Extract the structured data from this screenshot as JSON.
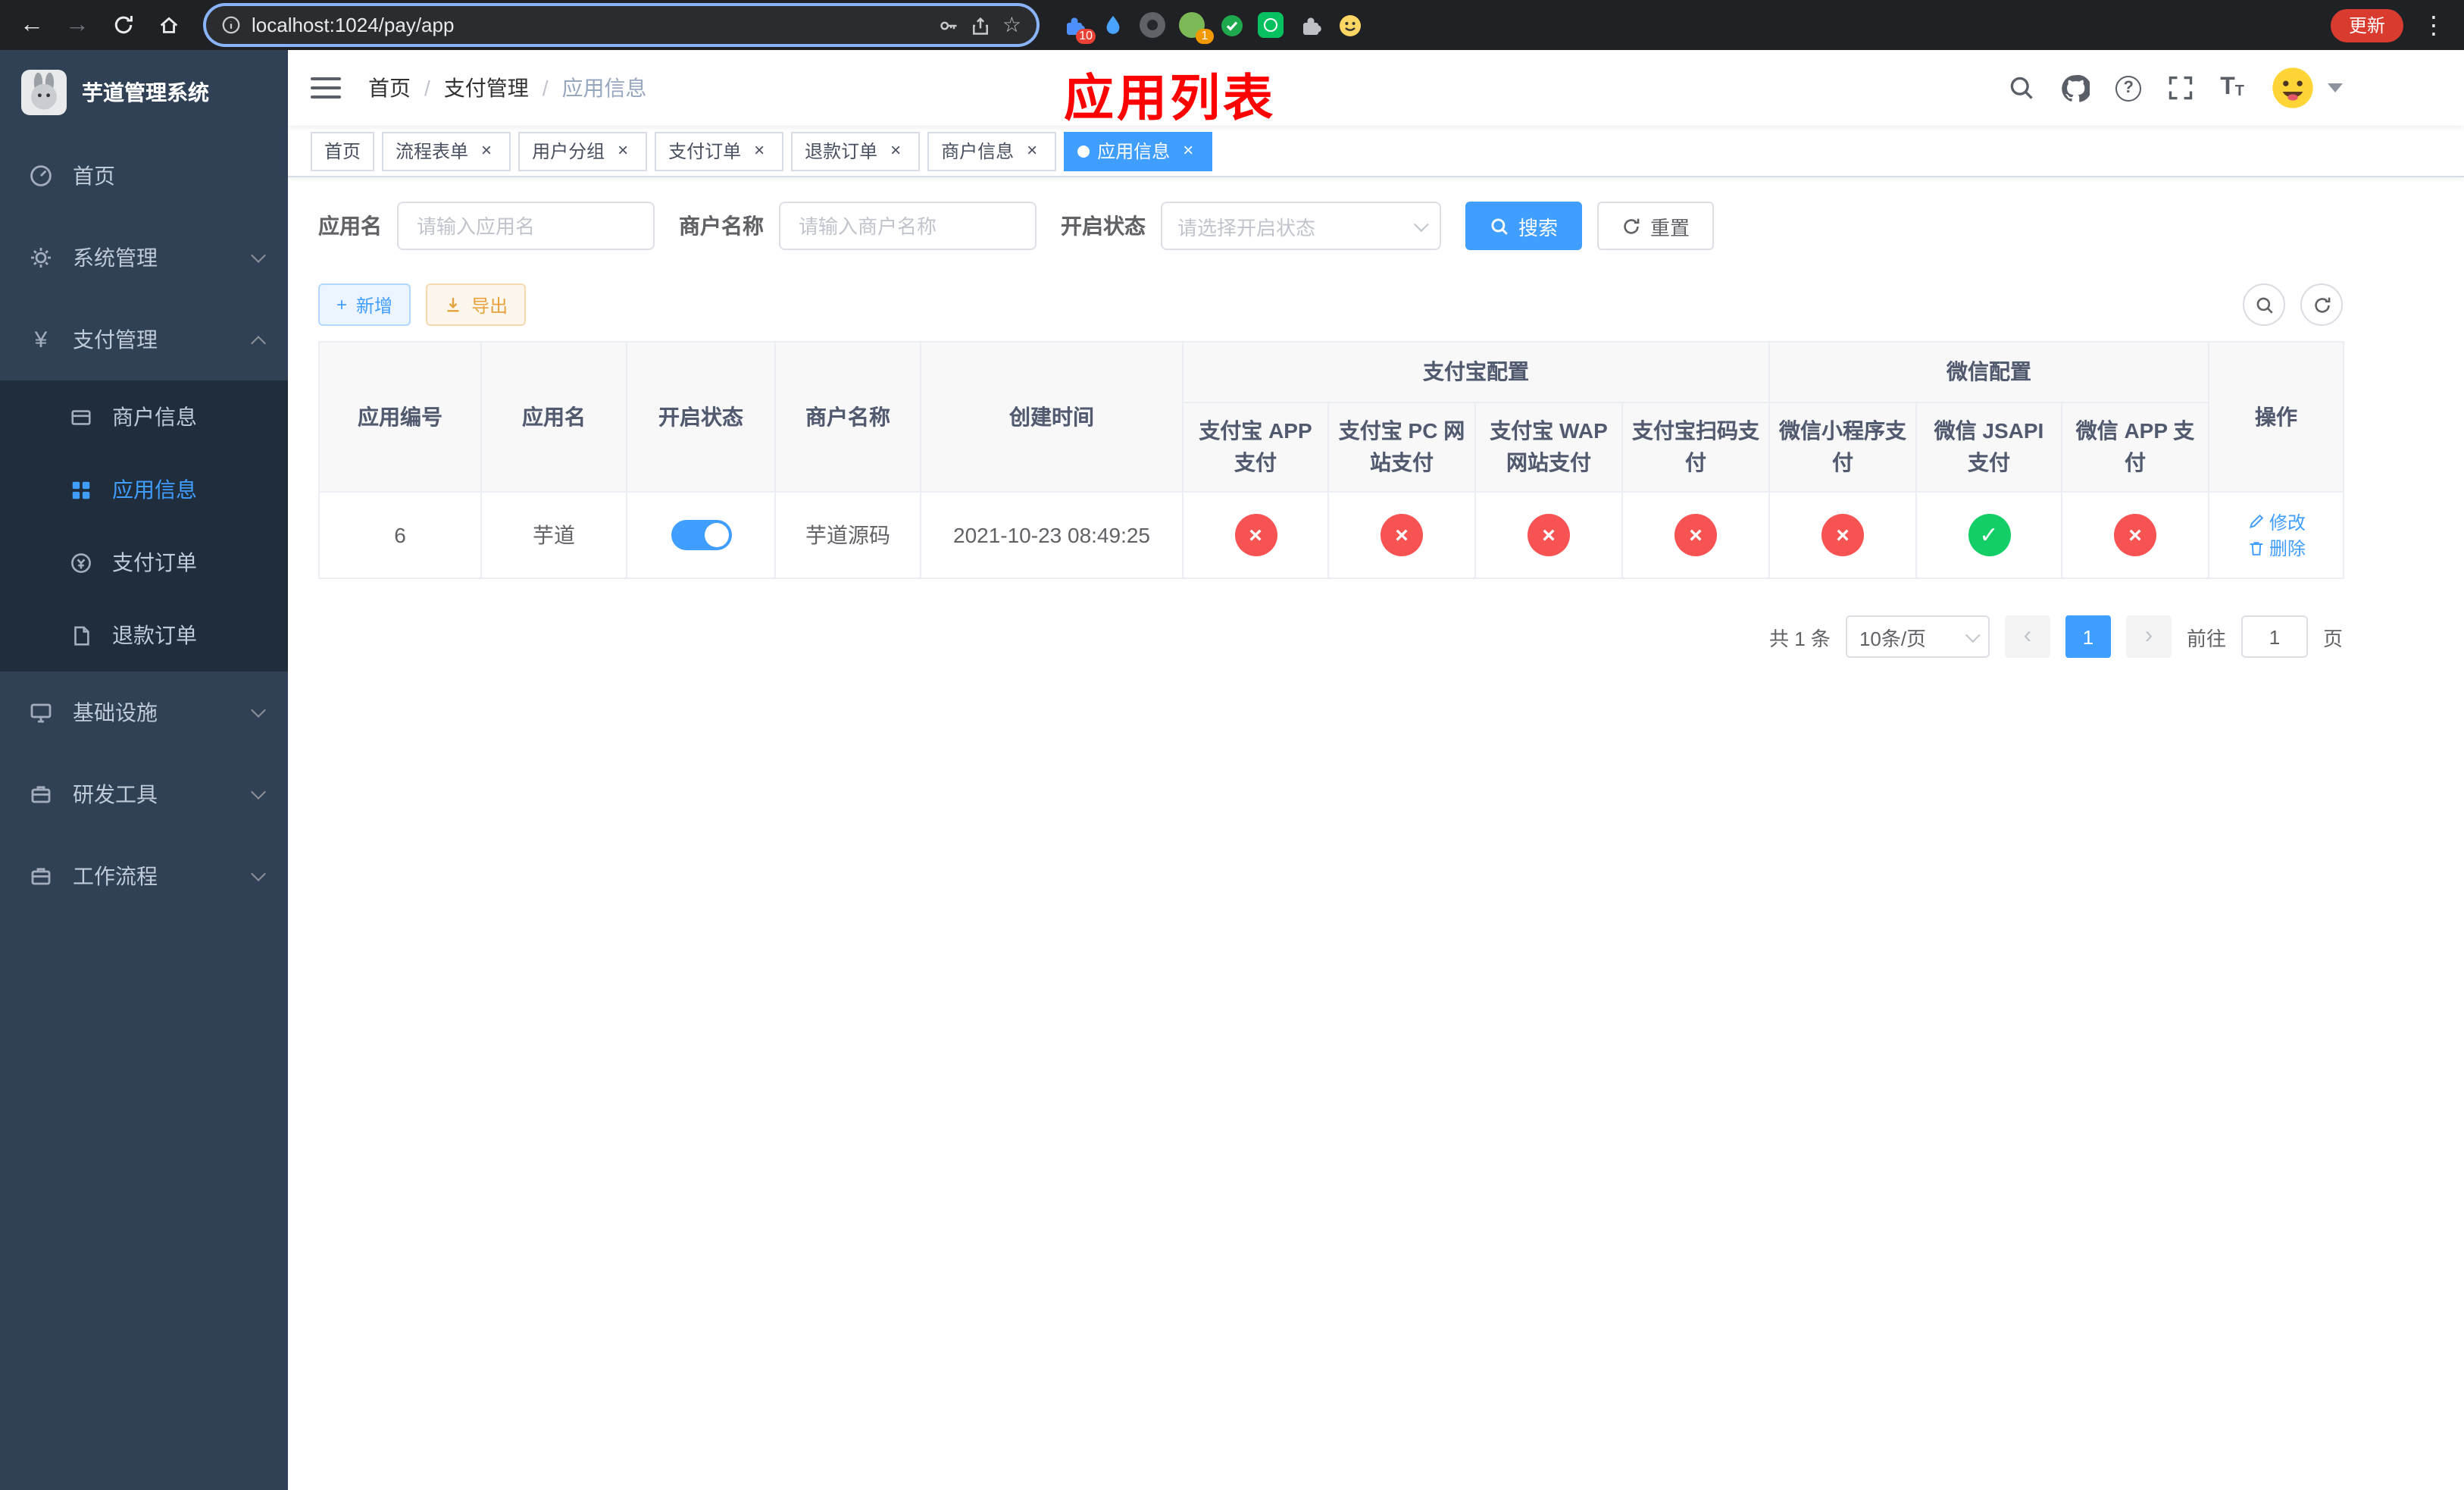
{
  "colors": {
    "accent": "#409eff",
    "success": "#13ce66",
    "danger": "#f75353",
    "warning": "#e6a23c",
    "annotation-red": "#ff0000",
    "sidebar-bg": "#304156",
    "sidebar-sub-bg": "#1f2d3d",
    "sidebar-text": "#bfcbd9",
    "chrome-bg": "#202124",
    "chrome-update": "#d93b2e"
  },
  "icons": {
    "back": "←",
    "forward": "→",
    "star": "☆",
    "menu_dots": "⋮",
    "help": "?",
    "plus": "+",
    "yen": "¥",
    "font_size": "T",
    "close": "×",
    "breadcrumb_separator": "/",
    "prev": "‹",
    "next": "›",
    "status_yes": "✓",
    "status_no": "×"
  },
  "browser": {
    "url": "localhost:1024/pay/app",
    "update_button": "更新",
    "extensions_badge": "10",
    "profile_badge": "1"
  },
  "sidebar": {
    "title": "芋道管理系统",
    "menu": [
      {
        "label": "首页"
      },
      {
        "label": "系统管理"
      },
      {
        "label": "支付管理"
      },
      {
        "label": "基础设施"
      },
      {
        "label": "研发工具"
      },
      {
        "label": "工作流程"
      }
    ],
    "pay_submenu": [
      {
        "label": "商户信息"
      },
      {
        "label": "应用信息"
      },
      {
        "label": "支付订单"
      },
      {
        "label": "退款订单"
      }
    ]
  },
  "navbar": {
    "breadcrumb": [
      "首页",
      "支付管理",
      "应用信息"
    ],
    "annotation": "应用列表"
  },
  "tabs": [
    {
      "label": "首页"
    },
    {
      "label": "流程表单"
    },
    {
      "label": "用户分组"
    },
    {
      "label": "支付订单"
    },
    {
      "label": "退款订单"
    },
    {
      "label": "商户信息"
    },
    {
      "label": "应用信息"
    }
  ],
  "filters": {
    "app_name_label": "应用名",
    "app_name_placeholder": "请输入应用名",
    "merchant_label": "商户名称",
    "merchant_placeholder": "请输入商户名称",
    "status_label": "开启状态",
    "status_placeholder": "请选择开启状态",
    "search_button": "搜索",
    "reset_button": "重置"
  },
  "toolbar": {
    "add_button": "新增",
    "export_button": "导出"
  },
  "table": {
    "headers": {
      "app_id": "应用编号",
      "app_name": "应用名",
      "status": "开启状态",
      "merchant": "商户名称",
      "create_time": "创建时间",
      "alipay_group": "支付宝配置",
      "wechat_group": "微信配置",
      "alipay_app": "支付宝 APP 支付",
      "alipay_pc": "支付宝 PC 网站支付",
      "alipay_wap": "支付宝 WAP 网站支付",
      "alipay_qr": "支付宝扫码支付",
      "wx_mini": "微信小程序支付",
      "wx_jsapi": "微信 JSAPI 支付",
      "wx_app": "微信 APP 支付",
      "actions": "操作"
    },
    "row": {
      "app_id": "6",
      "app_name": "芋道",
      "status_enabled": true,
      "merchant": "芋道源码",
      "create_time": "2021-10-23 08:49:25",
      "alipay_app": false,
      "alipay_pc": false,
      "alipay_wap": false,
      "alipay_qr": false,
      "wx_mini": false,
      "wx_jsapi": true,
      "wx_app": false,
      "edit": "修改",
      "delete": "删除"
    }
  },
  "pagination": {
    "total": "共 1 条",
    "page_size": "10条/页",
    "current_page": "1",
    "goto_prefix": "前往",
    "goto_value": "1",
    "goto_suffix": "页"
  }
}
